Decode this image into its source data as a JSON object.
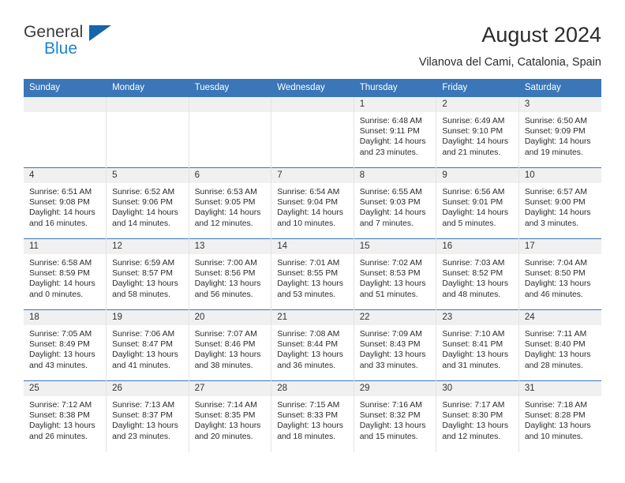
{
  "brand": {
    "name_top": "General",
    "name_bottom": "Blue",
    "accent_color": "#1b84d0",
    "triangle_color": "#1565a8"
  },
  "header": {
    "title": "August 2024",
    "subtitle": "Vilanova del Cami, Catalonia, Spain"
  },
  "theme": {
    "header_row_bg": "#3a76b8",
    "daynum_bg": "#f0f0f0",
    "text_color": "#2b2b2b"
  },
  "weekday_headers": [
    "Sunday",
    "Monday",
    "Tuesday",
    "Wednesday",
    "Thursday",
    "Friday",
    "Saturday"
  ],
  "weeks": [
    [
      {
        "empty": true
      },
      {
        "empty": true
      },
      {
        "empty": true
      },
      {
        "empty": true
      },
      {
        "day": "1",
        "sunrise": "Sunrise: 6:48 AM",
        "sunset": "Sunset: 9:11 PM",
        "daylight1": "Daylight: 14 hours",
        "daylight2": "and 23 minutes."
      },
      {
        "day": "2",
        "sunrise": "Sunrise: 6:49 AM",
        "sunset": "Sunset: 9:10 PM",
        "daylight1": "Daylight: 14 hours",
        "daylight2": "and 21 minutes."
      },
      {
        "day": "3",
        "sunrise": "Sunrise: 6:50 AM",
        "sunset": "Sunset: 9:09 PM",
        "daylight1": "Daylight: 14 hours",
        "daylight2": "and 19 minutes."
      }
    ],
    [
      {
        "day": "4",
        "sunrise": "Sunrise: 6:51 AM",
        "sunset": "Sunset: 9:08 PM",
        "daylight1": "Daylight: 14 hours",
        "daylight2": "and 16 minutes."
      },
      {
        "day": "5",
        "sunrise": "Sunrise: 6:52 AM",
        "sunset": "Sunset: 9:06 PM",
        "daylight1": "Daylight: 14 hours",
        "daylight2": "and 14 minutes."
      },
      {
        "day": "6",
        "sunrise": "Sunrise: 6:53 AM",
        "sunset": "Sunset: 9:05 PM",
        "daylight1": "Daylight: 14 hours",
        "daylight2": "and 12 minutes."
      },
      {
        "day": "7",
        "sunrise": "Sunrise: 6:54 AM",
        "sunset": "Sunset: 9:04 PM",
        "daylight1": "Daylight: 14 hours",
        "daylight2": "and 10 minutes."
      },
      {
        "day": "8",
        "sunrise": "Sunrise: 6:55 AM",
        "sunset": "Sunset: 9:03 PM",
        "daylight1": "Daylight: 14 hours",
        "daylight2": "and 7 minutes."
      },
      {
        "day": "9",
        "sunrise": "Sunrise: 6:56 AM",
        "sunset": "Sunset: 9:01 PM",
        "daylight1": "Daylight: 14 hours",
        "daylight2": "and 5 minutes."
      },
      {
        "day": "10",
        "sunrise": "Sunrise: 6:57 AM",
        "sunset": "Sunset: 9:00 PM",
        "daylight1": "Daylight: 14 hours",
        "daylight2": "and 3 minutes."
      }
    ],
    [
      {
        "day": "11",
        "sunrise": "Sunrise: 6:58 AM",
        "sunset": "Sunset: 8:59 PM",
        "daylight1": "Daylight: 14 hours",
        "daylight2": "and 0 minutes."
      },
      {
        "day": "12",
        "sunrise": "Sunrise: 6:59 AM",
        "sunset": "Sunset: 8:57 PM",
        "daylight1": "Daylight: 13 hours",
        "daylight2": "and 58 minutes."
      },
      {
        "day": "13",
        "sunrise": "Sunrise: 7:00 AM",
        "sunset": "Sunset: 8:56 PM",
        "daylight1": "Daylight: 13 hours",
        "daylight2": "and 56 minutes."
      },
      {
        "day": "14",
        "sunrise": "Sunrise: 7:01 AM",
        "sunset": "Sunset: 8:55 PM",
        "daylight1": "Daylight: 13 hours",
        "daylight2": "and 53 minutes."
      },
      {
        "day": "15",
        "sunrise": "Sunrise: 7:02 AM",
        "sunset": "Sunset: 8:53 PM",
        "daylight1": "Daylight: 13 hours",
        "daylight2": "and 51 minutes."
      },
      {
        "day": "16",
        "sunrise": "Sunrise: 7:03 AM",
        "sunset": "Sunset: 8:52 PM",
        "daylight1": "Daylight: 13 hours",
        "daylight2": "and 48 minutes."
      },
      {
        "day": "17",
        "sunrise": "Sunrise: 7:04 AM",
        "sunset": "Sunset: 8:50 PM",
        "daylight1": "Daylight: 13 hours",
        "daylight2": "and 46 minutes."
      }
    ],
    [
      {
        "day": "18",
        "sunrise": "Sunrise: 7:05 AM",
        "sunset": "Sunset: 8:49 PM",
        "daylight1": "Daylight: 13 hours",
        "daylight2": "and 43 minutes."
      },
      {
        "day": "19",
        "sunrise": "Sunrise: 7:06 AM",
        "sunset": "Sunset: 8:47 PM",
        "daylight1": "Daylight: 13 hours",
        "daylight2": "and 41 minutes."
      },
      {
        "day": "20",
        "sunrise": "Sunrise: 7:07 AM",
        "sunset": "Sunset: 8:46 PM",
        "daylight1": "Daylight: 13 hours",
        "daylight2": "and 38 minutes."
      },
      {
        "day": "21",
        "sunrise": "Sunrise: 7:08 AM",
        "sunset": "Sunset: 8:44 PM",
        "daylight1": "Daylight: 13 hours",
        "daylight2": "and 36 minutes."
      },
      {
        "day": "22",
        "sunrise": "Sunrise: 7:09 AM",
        "sunset": "Sunset: 8:43 PM",
        "daylight1": "Daylight: 13 hours",
        "daylight2": "and 33 minutes."
      },
      {
        "day": "23",
        "sunrise": "Sunrise: 7:10 AM",
        "sunset": "Sunset: 8:41 PM",
        "daylight1": "Daylight: 13 hours",
        "daylight2": "and 31 minutes."
      },
      {
        "day": "24",
        "sunrise": "Sunrise: 7:11 AM",
        "sunset": "Sunset: 8:40 PM",
        "daylight1": "Daylight: 13 hours",
        "daylight2": "and 28 minutes."
      }
    ],
    [
      {
        "day": "25",
        "sunrise": "Sunrise: 7:12 AM",
        "sunset": "Sunset: 8:38 PM",
        "daylight1": "Daylight: 13 hours",
        "daylight2": "and 26 minutes."
      },
      {
        "day": "26",
        "sunrise": "Sunrise: 7:13 AM",
        "sunset": "Sunset: 8:37 PM",
        "daylight1": "Daylight: 13 hours",
        "daylight2": "and 23 minutes."
      },
      {
        "day": "27",
        "sunrise": "Sunrise: 7:14 AM",
        "sunset": "Sunset: 8:35 PM",
        "daylight1": "Daylight: 13 hours",
        "daylight2": "and 20 minutes."
      },
      {
        "day": "28",
        "sunrise": "Sunrise: 7:15 AM",
        "sunset": "Sunset: 8:33 PM",
        "daylight1": "Daylight: 13 hours",
        "daylight2": "and 18 minutes."
      },
      {
        "day": "29",
        "sunrise": "Sunrise: 7:16 AM",
        "sunset": "Sunset: 8:32 PM",
        "daylight1": "Daylight: 13 hours",
        "daylight2": "and 15 minutes."
      },
      {
        "day": "30",
        "sunrise": "Sunrise: 7:17 AM",
        "sunset": "Sunset: 8:30 PM",
        "daylight1": "Daylight: 13 hours",
        "daylight2": "and 12 minutes."
      },
      {
        "day": "31",
        "sunrise": "Sunrise: 7:18 AM",
        "sunset": "Sunset: 8:28 PM",
        "daylight1": "Daylight: 13 hours",
        "daylight2": "and 10 minutes."
      }
    ]
  ]
}
